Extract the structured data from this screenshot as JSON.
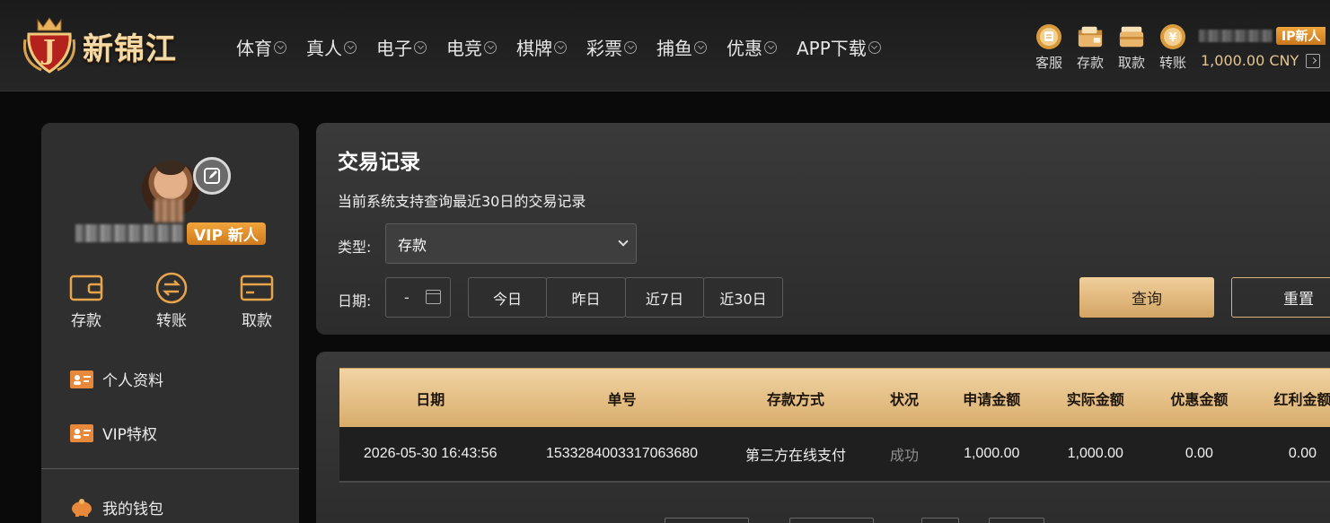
{
  "header": {
    "logo_text": "新锦江",
    "nav": [
      "体育",
      "真人",
      "电子",
      "电竞",
      "棋牌",
      "彩票",
      "捕鱼",
      "优惠",
      "APP下载"
    ],
    "quick": [
      {
        "label": "客服",
        "icon": "customer-service-icon"
      },
      {
        "label": "存款",
        "icon": "deposit-icon"
      },
      {
        "label": "取款",
        "icon": "withdraw-icon"
      },
      {
        "label": "转账",
        "icon": "transfer-icon"
      }
    ],
    "vip_label": "IP新人",
    "balance": "1,000.00 CNY",
    "colors": {
      "gold": "#e2c594",
      "vip": "#f0a63a"
    }
  },
  "sidebar": {
    "vip_badge": "VIP 新人",
    "actions": [
      {
        "label": "存款",
        "icon": "wallet-icon"
      },
      {
        "label": "转账",
        "icon": "transfer-icon"
      },
      {
        "label": "取款",
        "icon": "card-icon"
      }
    ],
    "menu": [
      {
        "label": "个人资料",
        "icon": "id-card-icon"
      },
      {
        "label": "VIP特权",
        "icon": "id-card-icon"
      },
      {
        "label": "我的钱包",
        "icon": "piggy-bank-icon"
      }
    ]
  },
  "filter": {
    "title": "交易记录",
    "subtitle": "当前系统支持查询最近30日的交易记录",
    "type_label": "类型:",
    "type_value": "存款",
    "date_label": "日期:",
    "date_value": "-",
    "ranges": [
      "今日",
      "昨日",
      "近7日",
      "近30日"
    ],
    "query_label": "查询",
    "reset_label": "重置"
  },
  "table": {
    "headers": [
      "日期",
      "单号",
      "存款方式",
      "状况",
      "申请金额",
      "实际金额",
      "优惠金额",
      "红利金额"
    ],
    "rows": [
      [
        "2026-05-30 16:43:56",
        "1533284003317063680",
        "第三方在线支付",
        "成功",
        "1,000.00",
        "1,000.00",
        "0.00",
        "0.00"
      ]
    ]
  }
}
